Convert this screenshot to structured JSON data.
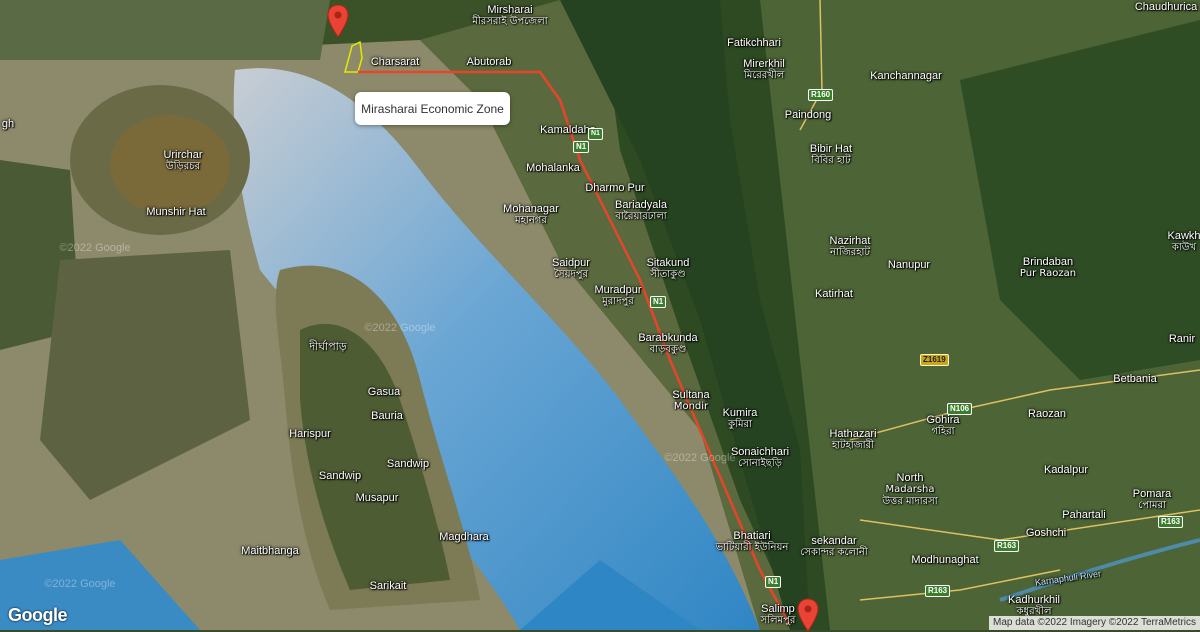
{
  "info_window": {
    "title": "Mirasharai Economic Zone"
  },
  "branding": {
    "logo": "Google"
  },
  "attribution": "Map data ©2022 Imagery ©2022 TerraMetrics",
  "watermarks": [
    "©2022 Google",
    "©2022 Google",
    "©2022 Google",
    "©2022 Google"
  ],
  "markers": [
    {
      "name": "marker-north",
      "icon": "map-pin-icon",
      "color": "#ea4335"
    },
    {
      "name": "marker-south",
      "icon": "map-pin-icon",
      "color": "#ea4335"
    }
  ],
  "colors": {
    "route": "#e8442a",
    "zone_outline": "#e6e600",
    "water": "#3d8fc8",
    "shallow": "#8f8f70",
    "land": "#3f5a30"
  },
  "places": {
    "mirsharai": {
      "en": "Mirsharai",
      "bn": "মীরসরাই উপজেলা"
    },
    "charsarat": {
      "en": "Charsarat"
    },
    "abutorab": {
      "en": "Abutorab"
    },
    "kamaldaha": {
      "en": "Kamaldaha"
    },
    "mohalanka": {
      "en": "Mohalanka"
    },
    "dharmo_pur": {
      "en": "Dharmo Pur"
    },
    "bariadyala": {
      "en": "Bariadyala",
      "bn": "বারৈয়ারঢালা"
    },
    "mohanagar": {
      "en": "Mohanagar",
      "bn": "মহানগর"
    },
    "saidpur": {
      "en": "Saidpur",
      "bn": "সৈয়দপুর"
    },
    "sitakund": {
      "en": "Sitakund",
      "bn": "সীতাকুণ্ড"
    },
    "muradpur": {
      "en": "Muradpur",
      "bn": "মুরাদপুর"
    },
    "barabkunda": {
      "en": "Barabkunda",
      "bn": "বাড়বকুণ্ড"
    },
    "sultana_mondir": {
      "en": "Sultana",
      "en2": "Mondir"
    },
    "kumira": {
      "en": "Kumira",
      "bn": "কুমিরা"
    },
    "sonaichhari": {
      "en": "Sonaichhari",
      "bn": "সোনাইছড়ি"
    },
    "bhatiari": {
      "en": "Bhatiari",
      "bn": "ভাটিয়ারী ইউনিয়ন"
    },
    "salimpur": {
      "en": "Salimp",
      "bn": "সলিমপুর"
    },
    "urirchar": {
      "en": "Urirchar",
      "bn": "উড়িরচর"
    },
    "munshir_hat": {
      "en": "Munshir Hat"
    },
    "dirghapar": {
      "bn": "দীর্ঘাপাড়"
    },
    "gasua": {
      "en": "Gasua"
    },
    "bauria": {
      "en": "Bauria"
    },
    "harispur": {
      "en": "Harispur"
    },
    "sandwip_w": {
      "en": "Sandwip"
    },
    "sandwip_e": {
      "en": "Sandwip"
    },
    "musapur": {
      "en": "Musapur"
    },
    "magdhara": {
      "en": "Magdhara"
    },
    "maitbhanga": {
      "en": "Maitbhanga"
    },
    "sarikait": {
      "en": "Sarikait"
    },
    "fatikchhari": {
      "en": "Fatikchhari"
    },
    "mirerkhil": {
      "en": "Mirerkhil",
      "bn": "মিরেরখীল"
    },
    "kanchannagar": {
      "en": "Kanchannagar"
    },
    "paindong": {
      "en": "Paindong"
    },
    "bibir_hat": {
      "en": "Bibir Hat",
      "bn": "বিবির হাট"
    },
    "nazirhat": {
      "en": "Nazirhat",
      "bn": "নাজিরহাট"
    },
    "nanupur": {
      "en": "Nanupur"
    },
    "brindaban": {
      "en": "Brindaban",
      "en2": "Pur Raozan"
    },
    "katirhat": {
      "en": "Katirhat"
    },
    "kawkh": {
      "en": "Kawkh",
      "bn": "কাউখ"
    },
    "ranir": {
      "en": "Ranir"
    },
    "betbania": {
      "en": "Betbania"
    },
    "raozan": {
      "en": "Raozan"
    },
    "gohira": {
      "en": "Gohira",
      "bn": "গহিরা"
    },
    "hathazari": {
      "en": "Hathazari",
      "bn": "হাটহাজারী"
    },
    "north_madarsha": {
      "en": "North",
      "en2": "Madarsha",
      "bn": "উত্তর মাদারসা"
    },
    "kadalpur": {
      "en": "Kadalpur"
    },
    "pomara": {
      "en": "Pomara",
      "bn": "পোমরা"
    },
    "pahartali": {
      "en": "Pahartali"
    },
    "goshchi": {
      "en": "Goshchi"
    },
    "sekandar": {
      "en": "sekandar",
      "bn": "সেকান্দর কলোনী"
    },
    "modhunaghat": {
      "en": "Modhunaghat"
    },
    "kadhurkhil": {
      "en": "Kadhurkhil",
      "bn": "কধুরখীল"
    },
    "karnaphuli": {
      "en": "Karnaphuli River"
    },
    "chaudhurica": {
      "en": "Chaudhurica"
    },
    "gh": {
      "en": "gh"
    }
  },
  "road_shields": {
    "n1_a": "N1",
    "n1_b": "N1",
    "n1_c": "N1",
    "n1_d": "N1",
    "r160": "R160",
    "z1619": "Z1619",
    "n106": "N106",
    "r163_a": "R163",
    "r163_b": "R163",
    "r163_c": "R163"
  }
}
